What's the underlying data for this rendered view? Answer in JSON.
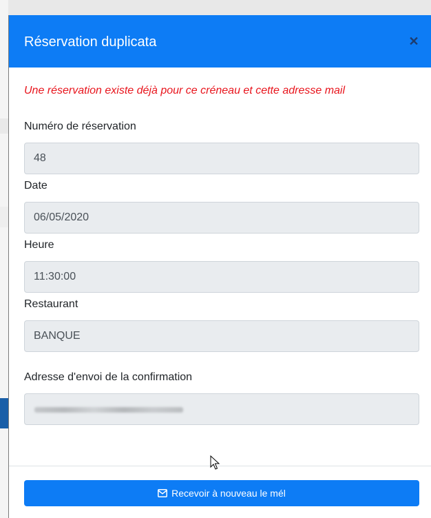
{
  "modal": {
    "title": "Réservation duplicata",
    "close_icon": "close-icon",
    "alert": "Une réservation existe déjà pour ce créneau et cette adresse mail",
    "fields": [
      {
        "label": "Numéro de réservation",
        "value": "48"
      },
      {
        "label": "Date",
        "value": "06/05/2020"
      },
      {
        "label": "Heure",
        "value": "11:30:00"
      },
      {
        "label": "Restaurant",
        "value": "BANQUE"
      },
      {
        "label": "Adresse d'envoi de la confirmation",
        "value": ""
      }
    ],
    "resend_button": {
      "label": "Recevoir à nouveau le mél",
      "icon": "envelope-icon"
    }
  },
  "colors": {
    "header_bg": "#0d7cf5",
    "button_bg": "#0d7cf5",
    "alert_text": "#e8141c",
    "input_bg": "#e9ecef"
  }
}
